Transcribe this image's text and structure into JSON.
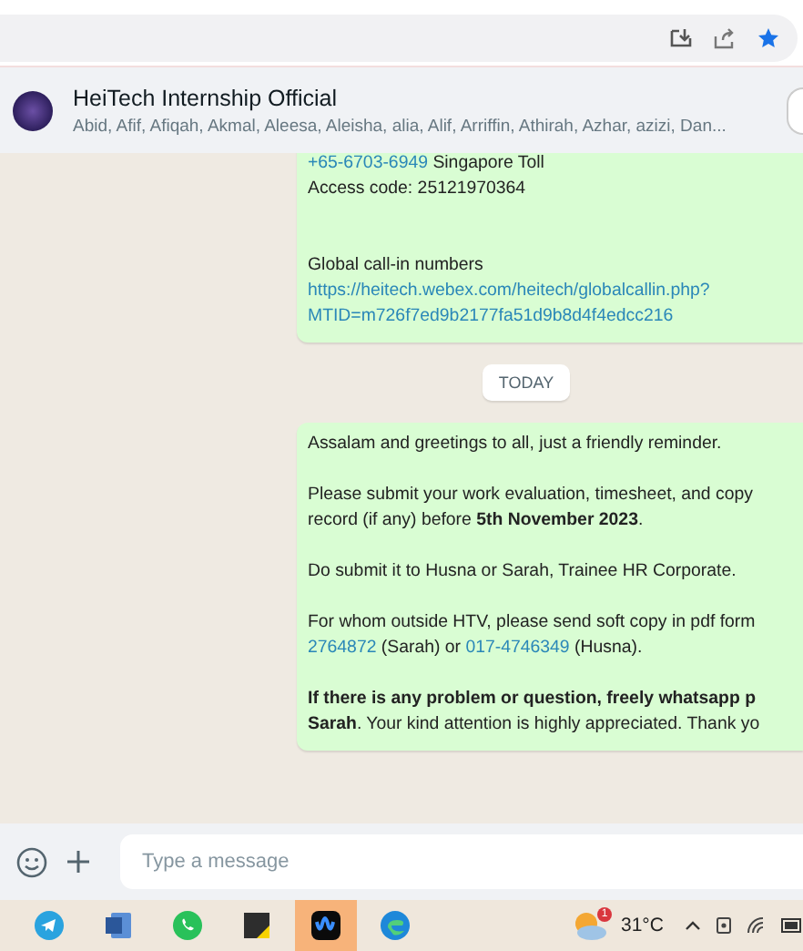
{
  "browser_bar": {
    "starred": true
  },
  "chat_header": {
    "title": "HeiTech Internship Official",
    "members": "Abid, Afif, Afiqah, Akmal, Aleesa, Aleisha, alia, Alif, Arriffin, Athirah, Azhar, azizi, Dan..."
  },
  "messages": [
    {
      "kind": "bubble",
      "paragraphs": [
        [
          [
            {
              "kind": "link",
              "text": "+65-6703-6949"
            },
            {
              "kind": "text",
              "text": " Singapore Toll"
            }
          ],
          [
            {
              "kind": "text",
              "text": "Access code: 25121970364"
            }
          ]
        ],
        {
          "extra_gap": true,
          "lines": [
            [
              {
                "kind": "text",
                "text": "Global call-in numbers"
              }
            ],
            [
              {
                "kind": "link",
                "text": "https://heitech.webex.com/heitech/globalcallin.php?"
              }
            ],
            [
              {
                "kind": "link",
                "text": "MTID=m726f7ed9b2177fa51d9b8d4f4edcc216"
              }
            ]
          ]
        }
      ]
    },
    {
      "kind": "date",
      "text": "TODAY"
    },
    {
      "kind": "bubble",
      "paragraphs": [
        [
          [
            {
              "kind": "text",
              "text": "Assalam and greetings to all, just a friendly reminder."
            }
          ]
        ],
        [
          [
            {
              "kind": "text",
              "text": "Please submit your work evaluation, timesheet, and copy"
            }
          ],
          [
            {
              "kind": "text",
              "text": "record (if any) before **5th November 2023**."
            }
          ]
        ],
        [
          [
            {
              "kind": "text",
              "text": "Do submit it to Husna or Sarah, Trainee HR Corporate."
            }
          ]
        ],
        [
          [
            {
              "kind": "text",
              "text": "For whom outside HTV, please send soft copy in pdf form"
            }
          ],
          [
            {
              "kind": "link",
              "text": "2764872"
            },
            {
              "kind": "text",
              "text": " (Sarah) or "
            },
            {
              "kind": "link",
              "text": "017-4746349"
            },
            {
              "kind": "text",
              "text": " (Husna)."
            }
          ]
        ],
        [
          [
            {
              "kind": "text",
              "text": "**If there is any problem or question, freely whatsapp p**"
            }
          ],
          [
            {
              "kind": "text",
              "text": "**Sarah**. Your kind attention is highly appreciated. Thank yo"
            }
          ]
        ]
      ]
    }
  ],
  "composer": {
    "placeholder": "Type a message"
  },
  "taskbar": {
    "apps": [
      {
        "kind": "telegram",
        "selected": false
      },
      {
        "kind": "word",
        "selected": false
      },
      {
        "kind": "whatsapp",
        "selected": false
      },
      {
        "kind": "notes",
        "selected": false
      },
      {
        "kind": "webex",
        "selected": true
      },
      {
        "kind": "edge",
        "selected": false
      }
    ],
    "weather_badge": "1",
    "temperature": "31°C"
  }
}
